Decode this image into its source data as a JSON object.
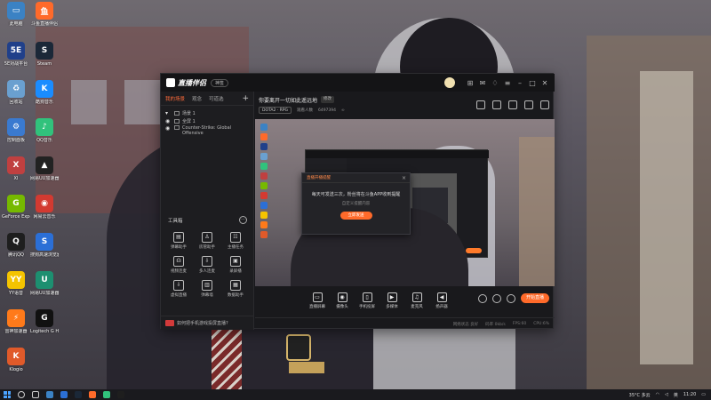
{
  "desktop": {
    "icons": [
      {
        "label": "此电脑",
        "color": "#3b82c4",
        "glyph": "▭"
      },
      {
        "label": "斗鱼直播伴侣",
        "color": "#ff6a2a",
        "glyph": "鱼"
      },
      {
        "label": "5E对战平台",
        "color": "#20408a",
        "glyph": "5E"
      },
      {
        "label": "Steam",
        "color": "#1b2838",
        "glyph": "S"
      },
      {
        "label": "回收站",
        "color": "#6aa0d0",
        "glyph": "♻"
      },
      {
        "label": "酷狗音乐",
        "color": "#1a8cff",
        "glyph": "K"
      },
      {
        "label": "控制面板",
        "color": "#3a7ad0",
        "glyph": "⚙"
      },
      {
        "label": "QQ音乐",
        "color": "#31c27c",
        "glyph": "♪"
      },
      {
        "label": "XI",
        "color": "#c04040",
        "glyph": "X"
      },
      {
        "label": "网易UU加速器",
        "color": "#222",
        "glyph": "▲"
      },
      {
        "label": "GeForce Experience",
        "color": "#76b900",
        "glyph": "G"
      },
      {
        "label": "网易云音乐",
        "color": "#d33a31",
        "glyph": "◉"
      },
      {
        "label": "腾讯QQ",
        "color": "#1e1e1e",
        "glyph": "Q"
      },
      {
        "label": "搜狗高速浏览器",
        "color": "#2b6fd6",
        "glyph": "S"
      },
      {
        "label": "YY语音",
        "color": "#f5c400",
        "glyph": "YY"
      },
      {
        "label": "网易UU加速器",
        "color": "#1d8f70",
        "glyph": "U"
      },
      {
        "label": "雷神加速器",
        "color": "#ff7a1a",
        "glyph": "⚡"
      },
      {
        "label": "Logitech G HUB",
        "color": "#111",
        "glyph": "G"
      },
      {
        "label": "Klogio",
        "color": "#e05a2a",
        "glyph": "K"
      }
    ]
  },
  "app": {
    "brand_name": "直播伴侣",
    "brand_badge": "神签",
    "left_tabs": [
      "我的场景",
      "观念",
      "可道选"
    ],
    "scenes": [
      {
        "label": "场景 1",
        "sub": false
      },
      {
        "label": "全屏 1",
        "sub": true
      },
      {
        "label": "Counter-Strike: Global Offensive",
        "sub": true
      }
    ],
    "tools_title": "工具箱",
    "tools": [
      {
        "label": "弹幕助手",
        "glyph": "▤"
      },
      {
        "label": "房管助手",
        "glyph": "♙"
      },
      {
        "label": "主播任务",
        "glyph": "☷"
      },
      {
        "label": "视频连麦",
        "glyph": "☊"
      },
      {
        "label": "多人连麦",
        "glyph": "⇩"
      },
      {
        "label": "录屏播",
        "glyph": "▣"
      },
      {
        "label": "虚拟直播",
        "glyph": "⇩"
      },
      {
        "label": "弹幕墙",
        "glyph": "▥"
      },
      {
        "label": "数据助手",
        "glyph": "▦"
      }
    ],
    "left_footer": "如何把手机游戏投屏直播?",
    "room_title": "你要离开一切如此遥远地",
    "room_edit": "修改",
    "game_tag": "DOTA2 · RPG",
    "room_meta": [
      "观看人数",
      "6497394",
      "∞"
    ],
    "dialog": {
      "header": "直播开播提醒",
      "message": "每天可发送三次，粉丝将在斗鱼APP收到提醒",
      "sub": "自定义提醒内容",
      "button": "立即发送"
    },
    "controls": [
      {
        "label": "直播屏幕",
        "glyph": "▭"
      },
      {
        "label": "摄像头",
        "glyph": "◉"
      },
      {
        "label": "手机投屏",
        "glyph": "▯"
      },
      {
        "label": "多媒体",
        "glyph": "▶"
      },
      {
        "label": "麦克风",
        "glyph": "♫"
      },
      {
        "label": "扬声器",
        "glyph": "◀"
      }
    ],
    "live_button": "开始直播",
    "status": [
      "网络状态 良好",
      "码率 0kb/s",
      "FPS:60",
      "CPU:6%"
    ]
  },
  "taskbar": {
    "weather": "35°C 多云",
    "ime": "英",
    "time": "11:20"
  },
  "colors": {
    "accent": "#ff6a2a",
    "panel": "#1d1d20"
  }
}
